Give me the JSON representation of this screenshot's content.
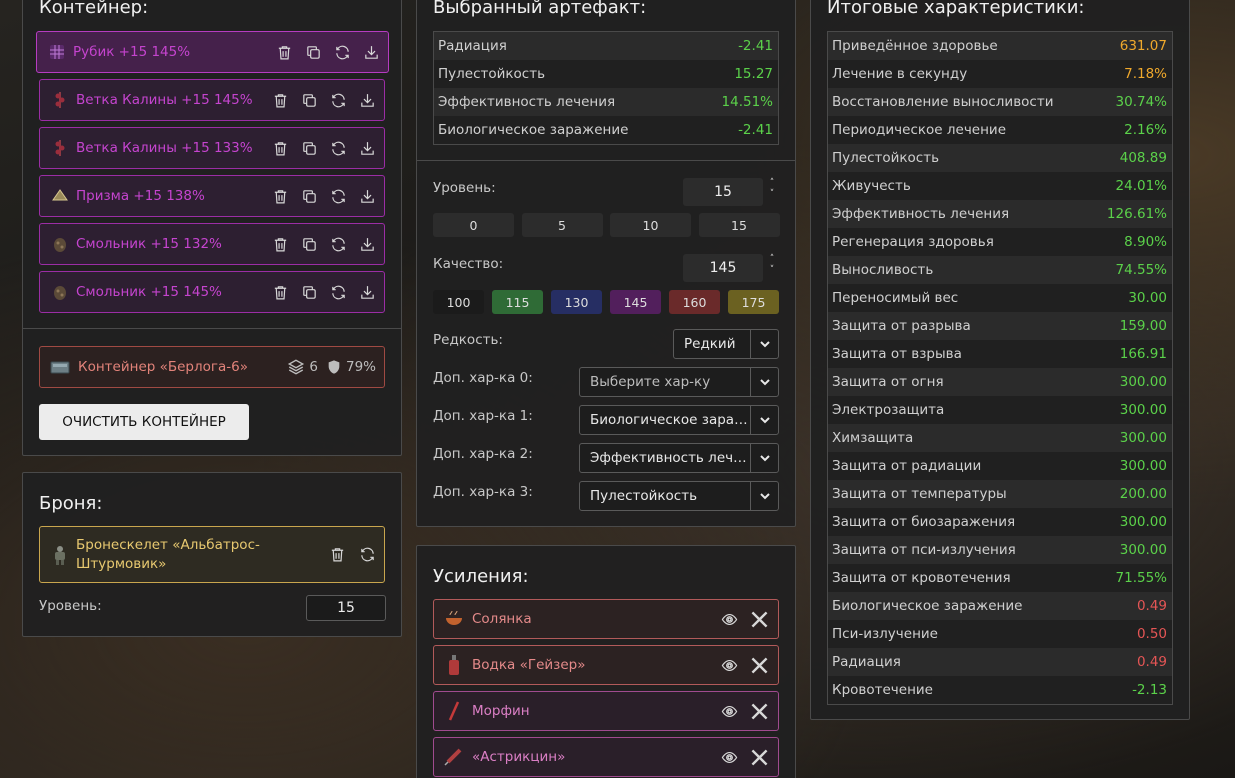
{
  "container": {
    "title": "Контейнер:",
    "artifacts": [
      {
        "label": "Рубик +15 145%",
        "icon": "rubik-icon"
      },
      {
        "label": "Ветка Калины +15 145%",
        "icon": "viburnum-icon"
      },
      {
        "label": "Ветка Калины +15 133%",
        "icon": "viburnum-icon"
      },
      {
        "label": "Призма +15 138%",
        "icon": "prism-icon"
      },
      {
        "label": "Смольник +15 132%",
        "icon": "resin-icon"
      },
      {
        "label": "Смольник +15 145%",
        "icon": "resin-icon"
      }
    ],
    "box": {
      "name": "Контейнер «Берлога-6»",
      "slots": "6",
      "protection": "79%"
    },
    "clear_button": "ОЧИСТИТЬ КОНТЕЙНЕР"
  },
  "armor": {
    "title": "Броня:",
    "name": "Бронескелет «Альбатрос-Штурмовик»",
    "level_label": "Уровень:",
    "level_value": "15"
  },
  "selected": {
    "title": "Выбранный артефакт:",
    "stats": [
      {
        "k": "Радиация",
        "v": "-2.41",
        "c": "green"
      },
      {
        "k": "Пулестойкость",
        "v": "15.27",
        "c": "green"
      },
      {
        "k": "Эффективность лечения",
        "v": "14.51%",
        "c": "green"
      },
      {
        "k": "Биологическое заражение",
        "v": "-2.41",
        "c": "green"
      }
    ],
    "level_label": "Уровень:",
    "level_value": "15",
    "level_presets": [
      "0",
      "5",
      "10",
      "15"
    ],
    "quality_label": "Качество:",
    "quality_value": "145",
    "quality_presets": [
      {
        "v": "100",
        "color": "#1b1b1b"
      },
      {
        "v": "115",
        "color": "#2f6b36"
      },
      {
        "v": "130",
        "color": "#262e63"
      },
      {
        "v": "145",
        "color": "#521f5c"
      },
      {
        "v": "160",
        "color": "#6a2a2a"
      },
      {
        "v": "175",
        "color": "#6b6121"
      }
    ],
    "rarity_label": "Редкость:",
    "rarity_value": "Редкий",
    "extras": [
      {
        "label": "Доп. хар-ка 0:",
        "value": "Выберите хар-ку",
        "placeholder": true
      },
      {
        "label": "Доп. хар-ка 1:",
        "value": "Биологическое заражение",
        "placeholder": false
      },
      {
        "label": "Доп. хар-ка 2:",
        "value": "Эффективность лечения",
        "placeholder": false
      },
      {
        "label": "Доп. хар-ка 3:",
        "value": "Пулестойкость",
        "placeholder": false
      }
    ]
  },
  "boosts": {
    "title": "Усиления:",
    "items": [
      {
        "name": "Солянка",
        "style": "red",
        "icon": "soup-icon"
      },
      {
        "name": "Водка «Гейзер»",
        "style": "red",
        "icon": "bottle-icon"
      },
      {
        "name": "Морфин",
        "style": "pink",
        "icon": "syringe-icon"
      },
      {
        "name": "«Астрикцин»",
        "style": "pink",
        "icon": "injector-icon"
      }
    ]
  },
  "summary": {
    "title": "Итоговые характеристики:",
    "stats": [
      {
        "k": "Приведённое здоровье",
        "v": "631.07",
        "c": "gold"
      },
      {
        "k": "Лечение в секунду",
        "v": "7.18%",
        "c": "gold"
      },
      {
        "k": "Восстановление выносливости",
        "v": "30.74%",
        "c": "green"
      },
      {
        "k": "Периодическое лечение",
        "v": "2.16%",
        "c": "green"
      },
      {
        "k": "Пулестойкость",
        "v": "408.89",
        "c": "green"
      },
      {
        "k": "Живучесть",
        "v": "24.01%",
        "c": "green"
      },
      {
        "k": "Эффективность лечения",
        "v": "126.61%",
        "c": "green"
      },
      {
        "k": "Регенерация здоровья",
        "v": "8.90%",
        "c": "green"
      },
      {
        "k": "Выносливость",
        "v": "74.55%",
        "c": "green"
      },
      {
        "k": "Переносимый вес",
        "v": "30.00",
        "c": "green"
      },
      {
        "k": "Защита от разрыва",
        "v": "159.00",
        "c": "green"
      },
      {
        "k": "Защита от взрыва",
        "v": "166.91",
        "c": "green"
      },
      {
        "k": "Защита от огня",
        "v": "300.00",
        "c": "green"
      },
      {
        "k": "Электрозащита",
        "v": "300.00",
        "c": "green"
      },
      {
        "k": "Химзащита",
        "v": "300.00",
        "c": "green"
      },
      {
        "k": "Защита от радиации",
        "v": "300.00",
        "c": "green"
      },
      {
        "k": "Защита от температуры",
        "v": "200.00",
        "c": "green"
      },
      {
        "k": "Защита от биозаражения",
        "v": "300.00",
        "c": "green"
      },
      {
        "k": "Защита от пси-излучения",
        "v": "300.00",
        "c": "green"
      },
      {
        "k": "Защита от кровотечения",
        "v": "71.55%",
        "c": "green"
      },
      {
        "k": "Биологическое заражение",
        "v": "0.49",
        "c": "red"
      },
      {
        "k": "Пси-излучение",
        "v": "0.50",
        "c": "red"
      },
      {
        "k": "Радиация",
        "v": "0.49",
        "c": "red"
      },
      {
        "k": "Кровотечение",
        "v": "-2.13",
        "c": "green"
      }
    ]
  }
}
